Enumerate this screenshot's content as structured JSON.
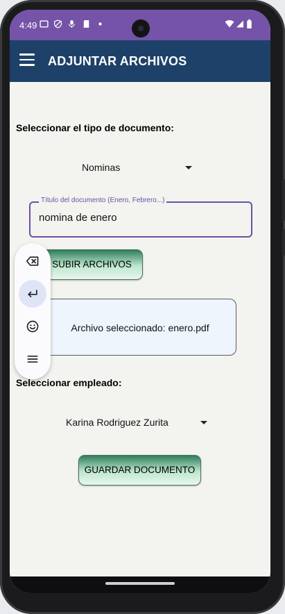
{
  "status_bar": {
    "time": "4:49"
  },
  "app_bar": {
    "title": "ADJUNTAR ARCHIVOS"
  },
  "form": {
    "doc_type_label": "Seleccionar el tipo de documento:",
    "doc_type_value": "Nominas",
    "title_field_label": "Título del documento (Enero, Febrero...)",
    "title_field_value": "nomina de enero",
    "upload_button": "SUBIR ARCHIVOS",
    "selected_file_text": "Archivo seleccionado: enero.pdf",
    "employee_label": "Seleccionar empleado:",
    "employee_value": "Karina Rodriguez Zurita",
    "save_button": "GUARDAR DOCUMENTO"
  },
  "colors": {
    "status_bar": "#7453a8",
    "app_bar": "#1d4169",
    "accent": "#6b4fa6",
    "background": "#f3f3ef"
  },
  "floating_toolbar": {
    "icons": [
      "backspace-icon",
      "enter-icon",
      "emoji-icon",
      "menu-icon"
    ]
  }
}
